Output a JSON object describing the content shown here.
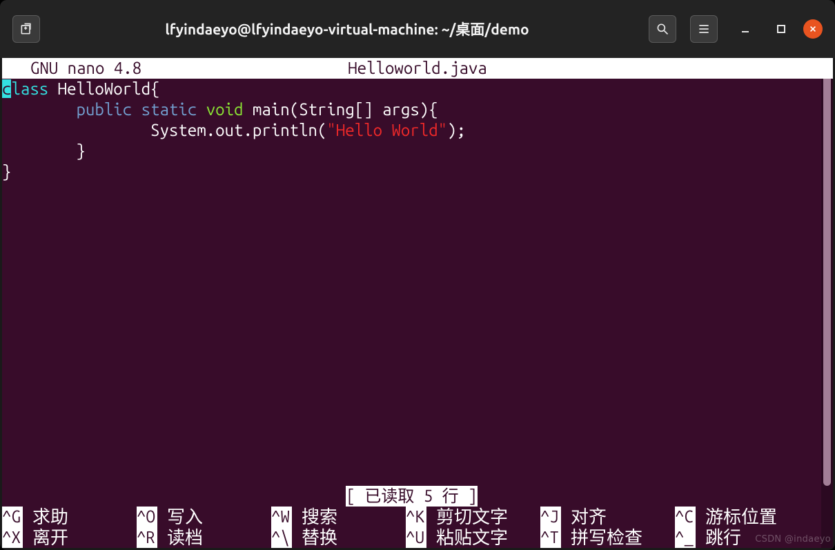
{
  "titlebar": {
    "title": "lfyindaeyo@lfyindaeyo-virtual-machine: ~/桌面/demo"
  },
  "nano": {
    "version_line": "  GNU nano 4.8",
    "filename": "Helloworld.java"
  },
  "code": {
    "line1_cursor": "c",
    "line1_kw": "lass",
    "line1_rest": " HelloWorld{",
    "line2_indent": "        ",
    "line2_kw_public": "public",
    "line2_kw_static": "static",
    "line2_kw_void": "void",
    "line2_rest": " main(String[] args){",
    "line3": "                System.out.println(",
    "line3_str": "\"Hello World\"",
    "line3_end": ");",
    "line4": "        }",
    "line5": "}"
  },
  "status": {
    "message": "[ 已读取 5 行 ]"
  },
  "shortcuts": {
    "row1": [
      {
        "key": "^G",
        "label": "求助"
      },
      {
        "key": "^O",
        "label": "写入"
      },
      {
        "key": "^W",
        "label": "搜索"
      },
      {
        "key": "^K",
        "label": "剪切文字"
      },
      {
        "key": "^J",
        "label": "对齐"
      },
      {
        "key": "^C",
        "label": "游标位置"
      }
    ],
    "row2": [
      {
        "key": "^X",
        "label": "离开"
      },
      {
        "key": "^R",
        "label": "读档"
      },
      {
        "key": "^\\",
        "label": "替换"
      },
      {
        "key": "^U",
        "label": "粘贴文字"
      },
      {
        "key": "^T",
        "label": "拼写检查"
      },
      {
        "key": "^_",
        "label": "跳行"
      }
    ]
  },
  "watermark": "CSDN @indaeyo"
}
